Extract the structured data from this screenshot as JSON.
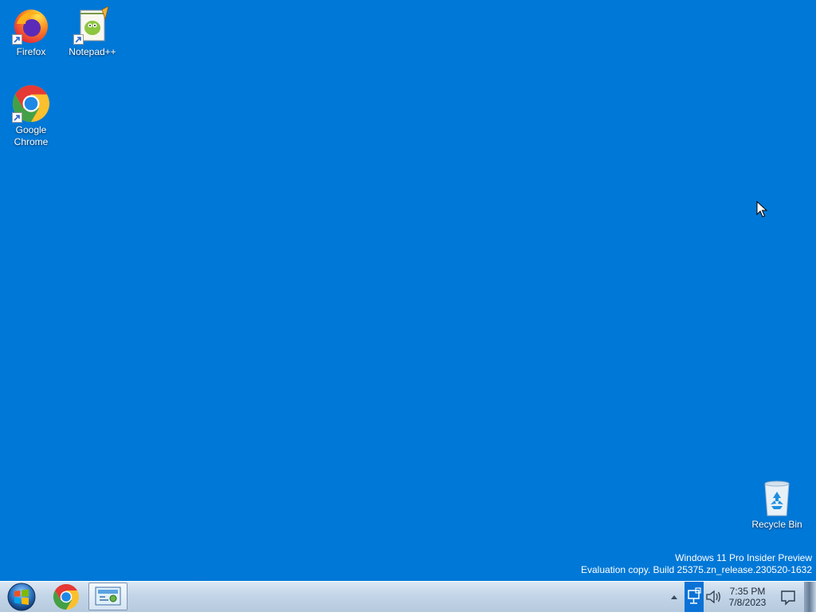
{
  "desktop": {
    "background_color": "#0078d7",
    "icons": [
      {
        "label": "Firefox",
        "icon": "firefox-icon",
        "shortcut": true
      },
      {
        "label": "Notepad++",
        "icon": "notepad-plus-plus-icon",
        "shortcut": true
      },
      {
        "label": "Google Chrome",
        "icon": "chrome-icon",
        "shortcut": true
      },
      {
        "label": "Recycle Bin",
        "icon": "recycle-bin-icon",
        "shortcut": false
      }
    ],
    "watermark": {
      "line1": "Windows 11 Pro Insider Preview",
      "line2": "Evaluation copy. Build 25375.zn_release.230520-1632"
    }
  },
  "taskbar": {
    "start_icon": "windows-start-orb-icon",
    "pinned": [
      {
        "name": "Google Chrome",
        "icon": "chrome-icon"
      },
      {
        "name": "Control Panel",
        "icon": "control-panel-icon",
        "active": true
      }
    ],
    "tray": {
      "icons": [
        "chevron-up-icon",
        "network-icon",
        "volume-icon"
      ],
      "time": "7:35 PM",
      "date": "7/8/2023",
      "action_center_icon": "notification-icon"
    }
  }
}
